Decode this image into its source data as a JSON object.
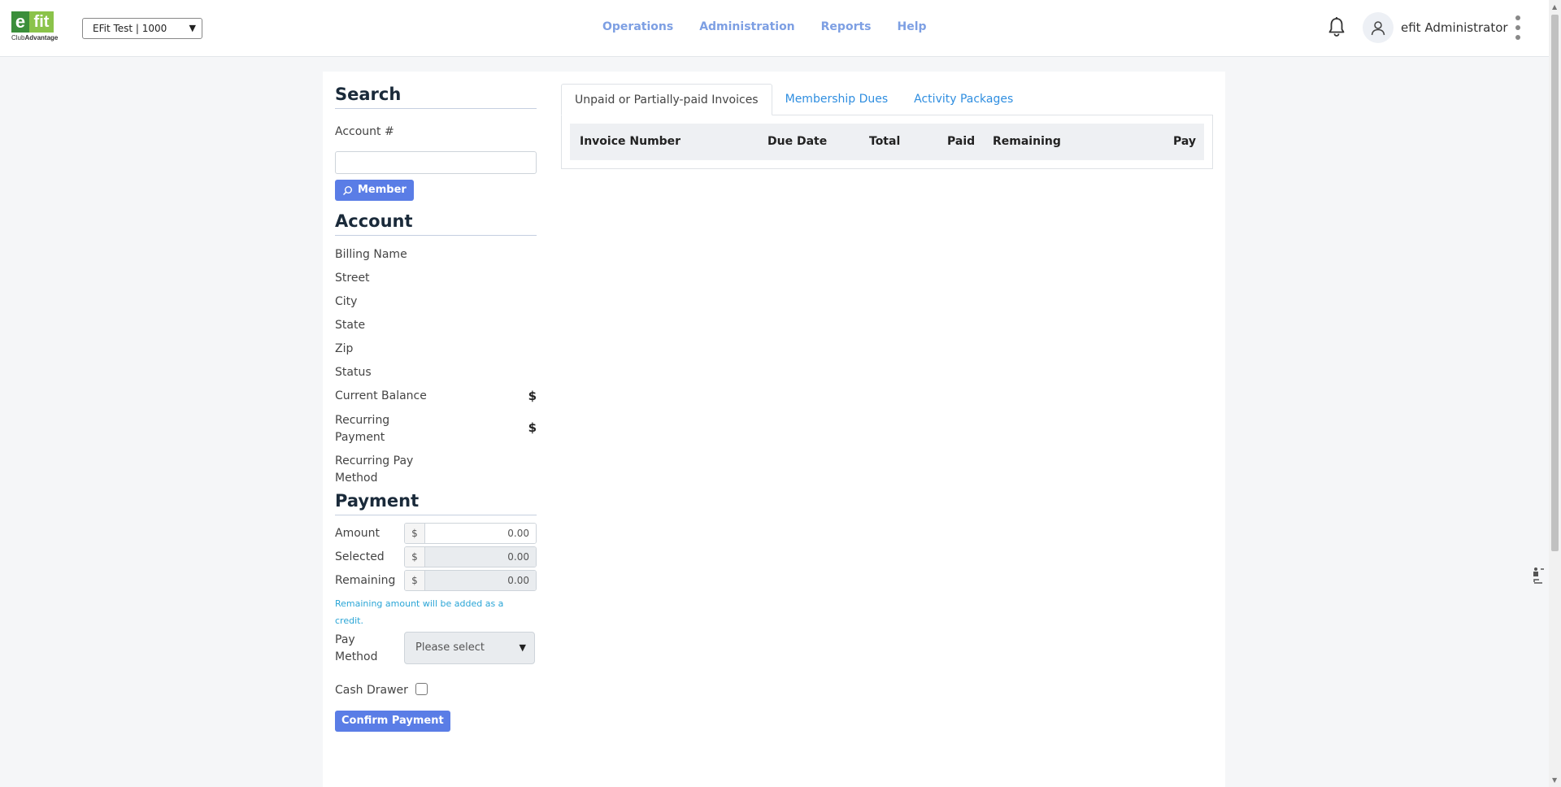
{
  "header": {
    "logo_letter": "e",
    "logo_fit": "fit",
    "logo_sub_1": "Club",
    "logo_sub_2": "Advantage",
    "club_selector_value": "EFit Test | 1000",
    "nav": [
      "Operations",
      "Administration",
      "Reports",
      "Help"
    ],
    "user_name": "efit Administrator"
  },
  "search": {
    "title": "Search",
    "account_label": "Account #",
    "account_value": "",
    "member_button": "Member"
  },
  "account": {
    "title": "Account",
    "fields": {
      "billing_name": "Billing Name",
      "street": "Street",
      "city": "City",
      "state": "State",
      "zip": "Zip",
      "status": "Status",
      "current_balance": "Current Balance",
      "current_balance_value": "$",
      "recurring_payment_1": "Recurring",
      "recurring_payment_2": "Payment",
      "recurring_payment_value": "$",
      "recurring_pay_method_1": "Recurring Pay",
      "recurring_pay_method_2": "Method"
    }
  },
  "payment": {
    "title": "Payment",
    "currency": "$",
    "amount_label": "Amount",
    "amount_value": "0.00",
    "selected_label": "Selected",
    "selected_value": "0.00",
    "remaining_label": "Remaining",
    "remaining_value": "0.00",
    "hint_1": "Remaining amount will be added as a",
    "hint_2": "credit.",
    "pay_method_label_1": "Pay",
    "pay_method_label_2": "Method",
    "pay_method_value": "Please select",
    "cash_drawer_label": "Cash Drawer",
    "cash_drawer_checked": false,
    "confirm_button": "Confirm Payment"
  },
  "tabs": {
    "items": [
      "Unpaid or Partially-paid Invoices",
      "Membership Dues",
      "Activity Packages"
    ],
    "active": 0
  },
  "invoice_table": {
    "columns": [
      "Invoice Number",
      "Due Date",
      "Total",
      "Paid",
      "Remaining",
      "Pay"
    ],
    "rows": []
  },
  "colors": {
    "primary": "#5a7de6",
    "nav_link": "#7d9fe3",
    "tab_link": "#2f8ee0",
    "hint": "#2aa5d6",
    "logo_dark_green": "#3b8e3b",
    "logo_light_green": "#8bc34a"
  }
}
